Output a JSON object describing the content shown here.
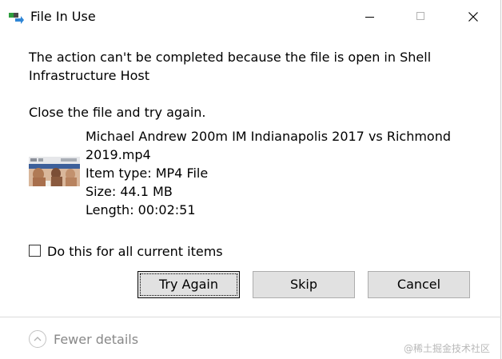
{
  "window": {
    "title": "File In Use",
    "icon": "file-transfer-icon"
  },
  "titlebar_buttons": {
    "minimize": "minimize-icon",
    "maximize": "maximize-icon",
    "close": "close-icon"
  },
  "message": {
    "line1": "The action can't be completed because the file is open in Shell",
    "line2": "Infrastructure Host",
    "instruction": "Close the file and try again."
  },
  "file": {
    "name_line1": "Michael Andrew 200m IM Indianapolis 2017 vs Richmond",
    "name_line2": "2019.mp4",
    "type": "Item type: MP4 File",
    "size": "Size: 44.1 MB",
    "length": "Length: 00:02:51",
    "thumbnail": "video-thumbnail"
  },
  "option": {
    "checkbox_label": "Do this for all current items",
    "checked": false
  },
  "buttons": {
    "try_again": "Try Again",
    "skip": "Skip",
    "cancel": "Cancel"
  },
  "footer": {
    "details_label": "Fewer details",
    "details_icon": "chevron-up-icon"
  },
  "watermark": "@稀土掘金技术社区"
}
